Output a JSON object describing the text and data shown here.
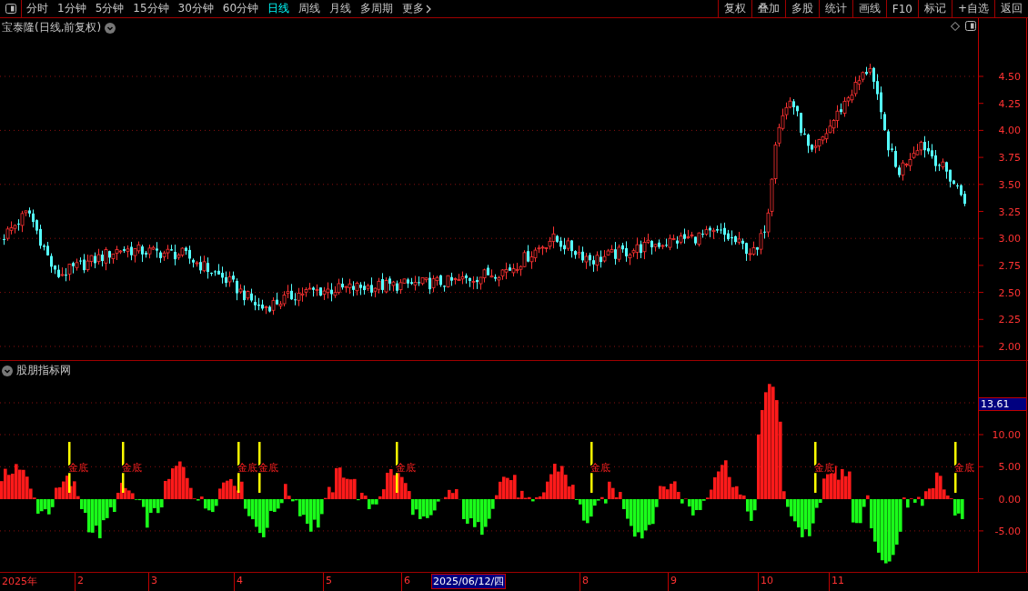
{
  "toolbar": {
    "periods": [
      {
        "label": "分时",
        "selected": false
      },
      {
        "label": "1分钟",
        "selected": false
      },
      {
        "label": "5分钟",
        "selected": false
      },
      {
        "label": "15分钟",
        "selected": false
      },
      {
        "label": "30分钟",
        "selected": false
      },
      {
        "label": "60分钟",
        "selected": false
      },
      {
        "label": "日线",
        "selected": true
      },
      {
        "label": "周线",
        "selected": false
      },
      {
        "label": "月线",
        "selected": false
      },
      {
        "label": "多周期",
        "selected": false
      },
      {
        "label": "更多",
        "selected": false,
        "kind": "menu"
      }
    ],
    "actions": [
      "复权",
      "叠加",
      "多股",
      "统计",
      "画线",
      "F10",
      "标记",
      "+自选",
      "返回"
    ]
  },
  "price_chart": {
    "title": "宝泰隆(日线,前复权)",
    "y_axis": [
      "4.50",
      "4.25",
      "4.00",
      "3.75",
      "3.50",
      "3.25",
      "3.00",
      "2.75",
      "2.50",
      "2.25",
      "2.00"
    ]
  },
  "indicator": {
    "title": "股朋指标网",
    "current_value": "13.61",
    "y_axis": [
      "10.00",
      "5.00",
      "0.00",
      "-5.00"
    ],
    "signals": [
      {
        "label": "金底"
      },
      {
        "label": "金底"
      },
      {
        "label": "金底"
      },
      {
        "label": "金底"
      },
      {
        "label": "金底"
      },
      {
        "label": "金底"
      },
      {
        "label": "金底"
      },
      {
        "label": "金底"
      }
    ]
  },
  "time_axis": [
    {
      "label": "2025年",
      "kind": "month"
    },
    {
      "label": "2",
      "kind": "month"
    },
    {
      "label": "3",
      "kind": "month"
    },
    {
      "label": "4",
      "kind": "month"
    },
    {
      "label": "5",
      "kind": "month"
    },
    {
      "label": "6",
      "kind": "month"
    },
    {
      "label": "2025/06/12/四",
      "kind": "cursor"
    },
    {
      "label": "8",
      "kind": "month"
    },
    {
      "label": "9",
      "kind": "month"
    },
    {
      "label": "10",
      "kind": "month"
    },
    {
      "label": "11",
      "kind": "month"
    }
  ]
}
